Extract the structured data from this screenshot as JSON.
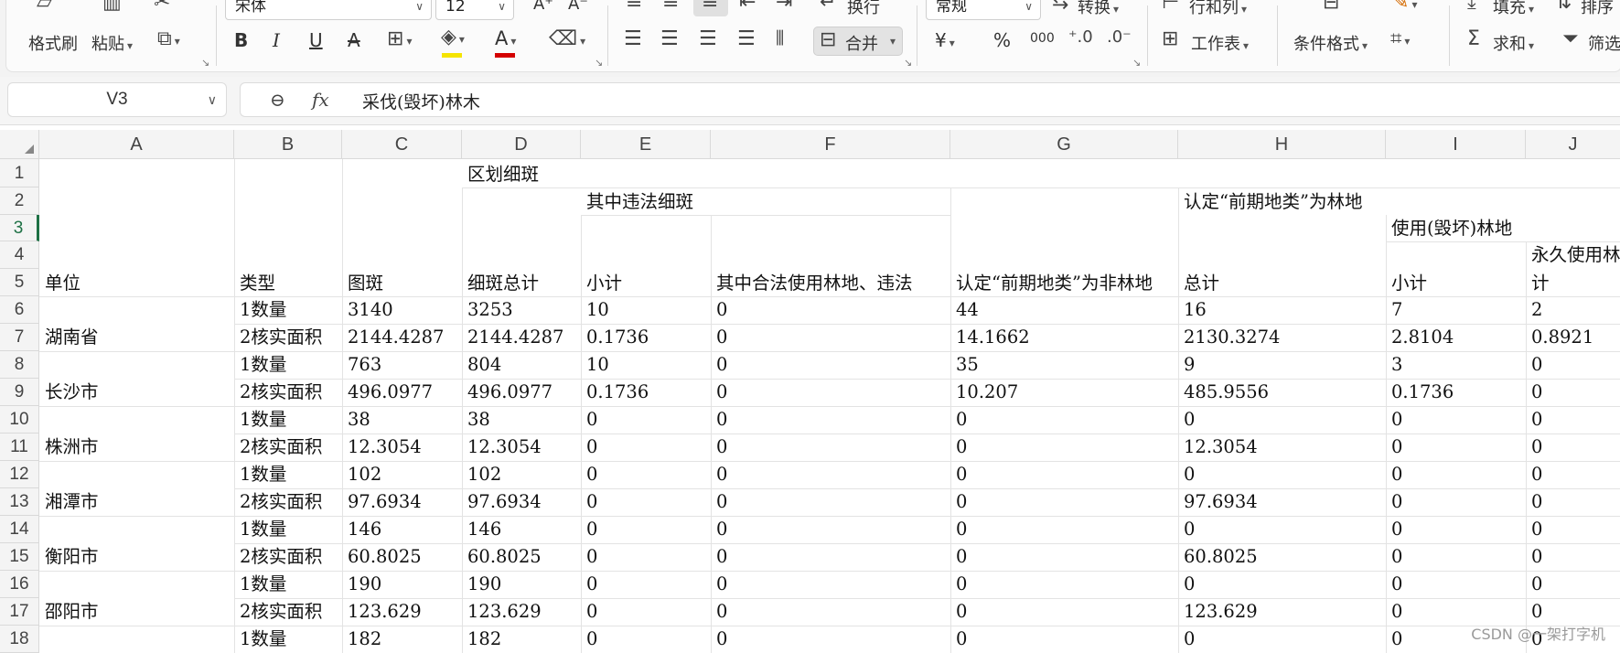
{
  "ribbon": {
    "font_name": "宋体",
    "font_size": "12",
    "number_format": "常规",
    "format_painter": "格式刷",
    "paste": "粘贴",
    "bold": "B",
    "italic": "I",
    "underline": "U",
    "strike": "A",
    "grow_font": "A⁺",
    "shrink_font": "A⁻",
    "wrap": "换行",
    "merge": "合并",
    "convert": "转换",
    "row_col": "行和列",
    "worksheet": "工作表",
    "conditional_format": "条件格式",
    "fill": "填充",
    "sum": "求和",
    "sort": "排序",
    "filter": "筛选",
    "currency": "¥",
    "percent": "%",
    "thousands": "000"
  },
  "formula_bar": {
    "cell_ref": "V3",
    "fx": "fx",
    "content": "采伐(毁坏)林木"
  },
  "columns": [
    "A",
    "B",
    "C",
    "D",
    "E",
    "F",
    "G",
    "H",
    "I",
    "J"
  ],
  "rows": [
    "1",
    "2",
    "3",
    "4",
    "5",
    "6",
    "7",
    "8",
    "9",
    "10",
    "11",
    "12",
    "13",
    "14",
    "15",
    "16",
    "17",
    "18"
  ],
  "header": {
    "d1": "区划细斑",
    "e2": "其中违法细斑",
    "h2": "认定“前期地类”为林地",
    "i3": "使用(毁坏)林地",
    "j4": "永久使用林地",
    "a5": "单位",
    "b5": "类型",
    "c5": "图斑",
    "d5": "细斑总计",
    "e5": "小计",
    "f5": "其中合法使用林地、违法",
    "g5": "认定“前期地类”为非林地",
    "h5": "总计",
    "i5": "小计",
    "j5": "计"
  },
  "data_rows": [
    {
      "a": "",
      "b": "1数量",
      "c": "3140",
      "d": "3253",
      "e": "10",
      "f": "0",
      "g": "44",
      "h": "16",
      "i": "7",
      "j": "2"
    },
    {
      "a": "湖南省",
      "b": "2核实面积",
      "c": "2144.4287",
      "d": "2144.4287",
      "e": "0.1736",
      "f": "0",
      "g": "14.1662",
      "h": "2130.3274",
      "i": "2.8104",
      "j": "0.8921"
    },
    {
      "a": "",
      "b": "1数量",
      "c": "763",
      "d": "804",
      "e": "10",
      "f": "0",
      "g": "35",
      "h": "9",
      "i": "3",
      "j": "0"
    },
    {
      "a": "长沙市",
      "b": "2核实面积",
      "c": "496.0977",
      "d": "496.0977",
      "e": "0.1736",
      "f": "0",
      "g": "10.207",
      "h": "485.9556",
      "i": "0.1736",
      "j": "0"
    },
    {
      "a": "",
      "b": "1数量",
      "c": "38",
      "d": "38",
      "e": "0",
      "f": "0",
      "g": "0",
      "h": "0",
      "i": "0",
      "j": "0"
    },
    {
      "a": "株洲市",
      "b": "2核实面积",
      "c": "12.3054",
      "d": "12.3054",
      "e": "0",
      "f": "0",
      "g": "0",
      "h": "12.3054",
      "i": "0",
      "j": "0"
    },
    {
      "a": "",
      "b": "1数量",
      "c": "102",
      "d": "102",
      "e": "0",
      "f": "0",
      "g": "0",
      "h": "0",
      "i": "0",
      "j": "0"
    },
    {
      "a": "湘潭市",
      "b": "2核实面积",
      "c": "97.6934",
      "d": "97.6934",
      "e": "0",
      "f": "0",
      "g": "0",
      "h": "97.6934",
      "i": "0",
      "j": "0"
    },
    {
      "a": "",
      "b": "1数量",
      "c": "146",
      "d": "146",
      "e": "0",
      "f": "0",
      "g": "0",
      "h": "0",
      "i": "0",
      "j": "0"
    },
    {
      "a": "衡阳市",
      "b": "2核实面积",
      "c": "60.8025",
      "d": "60.8025",
      "e": "0",
      "f": "0",
      "g": "0",
      "h": "60.8025",
      "i": "0",
      "j": "0"
    },
    {
      "a": "",
      "b": "1数量",
      "c": "190",
      "d": "190",
      "e": "0",
      "f": "0",
      "g": "0",
      "h": "0",
      "i": "0",
      "j": "0"
    },
    {
      "a": "邵阳市",
      "b": "2核实面积",
      "c": "123.629",
      "d": "123.629",
      "e": "0",
      "f": "0",
      "g": "0",
      "h": "123.629",
      "i": "0",
      "j": "0"
    },
    {
      "a": "",
      "b": "1数量",
      "c": "182",
      "d": "182",
      "e": "0",
      "f": "0",
      "g": "0",
      "h": "0",
      "i": "0",
      "j": "0"
    }
  ],
  "watermark": "CSDN @一架打字机",
  "colors": {
    "accent": "#1e7145",
    "fill_yellow": "#f5e400",
    "font_red": "#d40000"
  }
}
